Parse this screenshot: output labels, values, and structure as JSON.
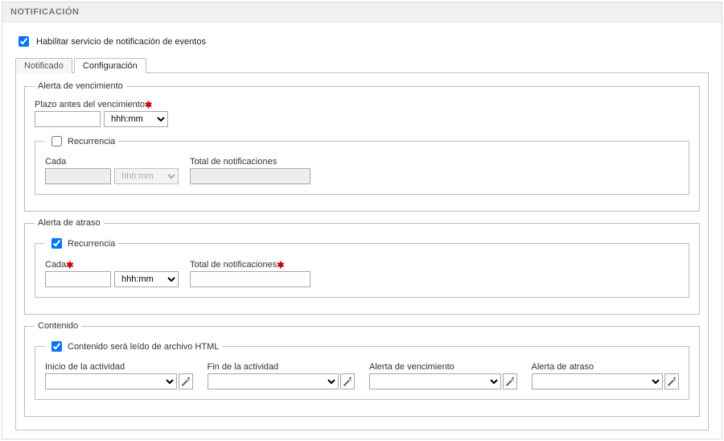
{
  "panel": {
    "title": "NOTIFICACIÓN"
  },
  "enable": {
    "checked": true,
    "label": "Habilitar servicio de notificación de eventos"
  },
  "tabs": {
    "notificado": "Notificado",
    "configuracion": "Configuración",
    "active": "configuracion"
  },
  "vencimiento": {
    "legend": "Alerta de vencimiento",
    "plazo_label": "Plazo antes del vencimiento",
    "plazo_required": true,
    "plazo_value": "",
    "unit_selected": "hhh:mm",
    "recurrencia": {
      "legend": "Recurrencia",
      "checked": false,
      "cada_label": "Cada",
      "cada_value": "",
      "unit_selected": "hhh:mm",
      "total_label": "Total de notificaciones",
      "total_value": ""
    }
  },
  "atraso": {
    "legend": "Alerta de atraso",
    "recurrencia": {
      "legend": "Recurrencia",
      "checked": true,
      "cada_label": "Cada",
      "cada_required": true,
      "cada_value": "",
      "unit_selected": "hhh:mm",
      "total_label": "Total de notificaciones",
      "total_required": true,
      "total_value": ""
    }
  },
  "contenido": {
    "legend": "Contenido",
    "html_check": {
      "checked": true,
      "label": "Contenido será leído de archivo HTML"
    },
    "fields": {
      "inicio": {
        "label": "Inicio de la actividad",
        "value": ""
      },
      "fin": {
        "label": "Fin de la actividad",
        "value": ""
      },
      "alerta_venc": {
        "label": "Alerta de vencimiento",
        "value": ""
      },
      "alerta_atraso": {
        "label": "Alerta de atraso",
        "value": ""
      }
    }
  },
  "icons": {
    "wand": "wand-icon"
  },
  "unit_options": [
    "hhh:mm"
  ]
}
